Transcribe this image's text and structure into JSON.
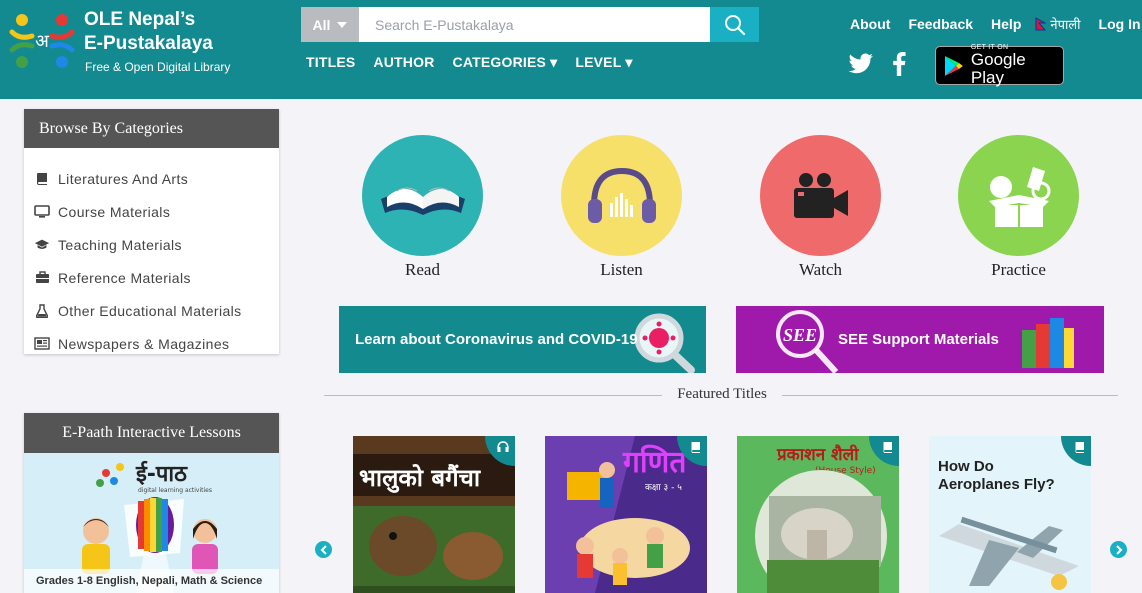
{
  "header": {
    "brand_title_line1": "OLE Nepal’s",
    "brand_title_line2": "E-Pustakalaya",
    "brand_subtitle": "Free & Open Digital Library",
    "logo_letter": "अ",
    "search": {
      "category": "All",
      "placeholder": "Search E-Pustakalaya"
    },
    "nav": [
      "TITLES",
      "AUTHOR",
      "CATEGORIES ▾",
      "LEVEL ▾"
    ],
    "links": {
      "about": "About",
      "feedback": "Feedback",
      "help": "Help",
      "language": "नेपाली",
      "login": "Log In"
    },
    "google_play": {
      "small": "GET IT ON",
      "big": "Google Play"
    }
  },
  "sidebar": {
    "categories_title": "Browse By Categories",
    "categories": [
      {
        "label": "Literatures And Arts",
        "icon": "book-icon"
      },
      {
        "label": "Course Materials",
        "icon": "monitor-icon"
      },
      {
        "label": "Teaching Materials",
        "icon": "graduation-cap-icon"
      },
      {
        "label": "Reference Materials",
        "icon": "briefcase-icon"
      },
      {
        "label": "Other Educational Materials",
        "icon": "flask-icon"
      },
      {
        "label": "Newspapers & Magazines",
        "icon": "newspaper-icon"
      }
    ],
    "epaath_title": "E-Paath Interactive Lessons",
    "epaath_logo": "ई-पाठ",
    "epaath_tagline": "digital learning activities",
    "epaath_caption": "Grades 1-8 English, Nepali, Math & Science"
  },
  "media": [
    {
      "label": "Read",
      "color": "#2db3b3"
    },
    {
      "label": "Listen",
      "color": "#f6e06a"
    },
    {
      "label": "Watch",
      "color": "#ef6a6a"
    },
    {
      "label": "Practice",
      "color": "#8bd44f"
    }
  ],
  "banners": {
    "covid": "Learn about Coronavirus and COVID-19",
    "see_badge": "SEE",
    "see": "SEE Support Materials"
  },
  "featured": {
    "title": "Featured Titles",
    "books": [
      {
        "title": "भालुको बगैंचा",
        "type": "headphones-icon"
      },
      {
        "title": "गणित",
        "subtitle": "कक्षा ३ - ५",
        "type": "book-icon"
      },
      {
        "title": "प्रकाशन शैली",
        "subtitle": "(House Style)",
        "type": "book-icon"
      },
      {
        "title": "How Do Aeroplanes Fly?",
        "type": "book-icon"
      }
    ]
  }
}
